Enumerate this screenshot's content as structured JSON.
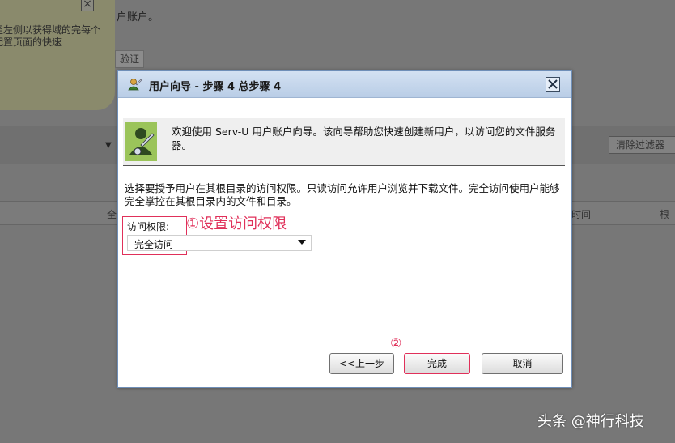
{
  "background": {
    "tip_text": "至左侧以获得域的完每个配置页面的快速",
    "title_fragment": "户账户。",
    "tab_label": "验证",
    "clear_filter_button": "清除过滤器",
    "column_fragment_1": "全",
    "column_fragment_2": "时间",
    "column_fragment_3": "根"
  },
  "dialog": {
    "title": "用户向导 - 步骤 4 总步骤 4",
    "welcome_text": "欢迎使用 Serv-U 用户账户向导。该向导帮助您快速创建新用户，以访问您的文件服务器。",
    "instructions": "选择要授予用户在其根目录的访问权限。只读访问允许用户浏览并下载文件。完全访问使用户能够完全掌控在其根目录内的文件和目录。",
    "access_label": "访问权限:",
    "access_value": "完全访问",
    "back_button": "<<上一步",
    "finish_button": "完成",
    "cancel_button": "取消"
  },
  "annotations": {
    "step1": "①设置访问权限",
    "step2": "②"
  },
  "watermark": "头条 @神行科技",
  "colors": {
    "annotation": "#e0305a",
    "titlebar": "#c6d7ec",
    "overlay": "#777777"
  },
  "icons": {
    "title_icon": "wizard-user-icon",
    "welcome_icon": "user-wizard-icon",
    "close_icon": "close-icon"
  }
}
